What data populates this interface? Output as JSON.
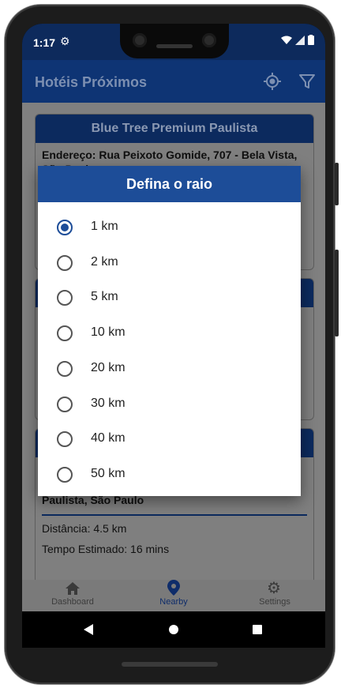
{
  "status_bar": {
    "time": "1:17"
  },
  "app_bar": {
    "title": "Hotéis Próximos"
  },
  "cards": [
    {
      "title": "Blue Tree Premium Paulista",
      "address": "Endereço: Rua Peixoto Gomide, 707 - Bela Vista, São Paulo"
    },
    {
      "title": ""
    },
    {
      "title": "",
      "address_tail": "Paulista, São Paulo",
      "distance": "Distância: 4.5 km",
      "time_estimate": "Tempo Estimado: 16 mins"
    }
  ],
  "dialog": {
    "title": "Defina o raio",
    "selected_index": 0,
    "options": [
      "1 km",
      "2 km",
      "5 km",
      "10 km",
      "20 km",
      "30 km",
      "40 km",
      "50 km"
    ]
  },
  "bottom_nav": {
    "items": [
      {
        "label": "Dashboard",
        "icon": "home-icon"
      },
      {
        "label": "Nearby",
        "icon": "location-pin-icon"
      },
      {
        "label": "Settings",
        "icon": "gear-icon"
      }
    ],
    "active_index": 1
  },
  "colors": {
    "primary": "#1d4d98",
    "appbar_dimmed": "#0e3474",
    "scrim_gray": "#808080"
  }
}
